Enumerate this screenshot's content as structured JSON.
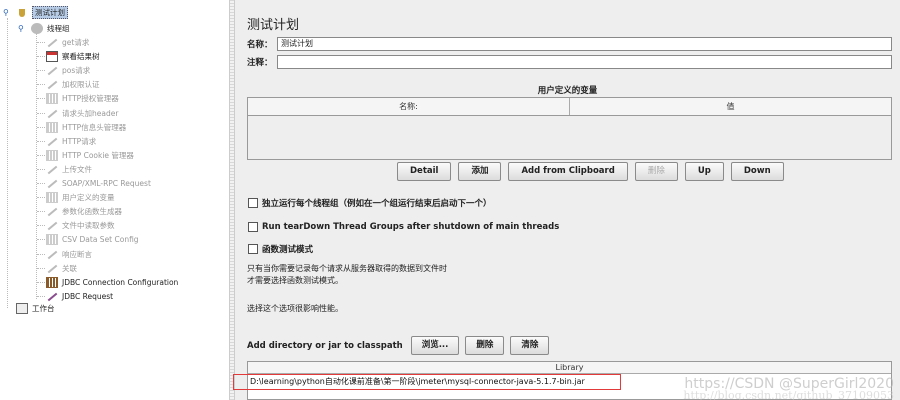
{
  "tree": {
    "root": {
      "label": "测试计划"
    },
    "thread_group": {
      "label": "线程组"
    },
    "items": [
      {
        "label": "get请求",
        "icon": "pen-icon",
        "enabled": false
      },
      {
        "label": "察看结果树",
        "icon": "results-tree-icon",
        "enabled": true
      },
      {
        "label": "pos请求",
        "icon": "pen-icon",
        "enabled": false
      },
      {
        "label": "加权限认证",
        "icon": "pen-icon",
        "enabled": false
      },
      {
        "label": "HTTP授权管理器",
        "icon": "config-grid-icon",
        "enabled": false
      },
      {
        "label": "请求头加header",
        "icon": "pen-icon",
        "enabled": false
      },
      {
        "label": "HTTP信息头管理器",
        "icon": "config-grid-icon",
        "enabled": false
      },
      {
        "label": "HTTP请求",
        "icon": "pen-icon",
        "enabled": false
      },
      {
        "label": "HTTP Cookie 管理器",
        "icon": "config-grid-icon",
        "enabled": false
      },
      {
        "label": "上传文件",
        "icon": "pen-icon",
        "enabled": false
      },
      {
        "label": "SOAP/XML-RPC Request",
        "icon": "pen-icon",
        "enabled": false
      },
      {
        "label": "用户定义的变量",
        "icon": "config-grid-icon",
        "enabled": false
      },
      {
        "label": "参数化函数生成器",
        "icon": "pen-icon",
        "enabled": false
      },
      {
        "label": "文件中读取参数",
        "icon": "pen-icon",
        "enabled": false
      },
      {
        "label": "CSV Data Set Config",
        "icon": "config-grid-icon",
        "enabled": false
      },
      {
        "label": "响应断言",
        "icon": "assertion-icon",
        "enabled": false
      },
      {
        "label": "关联",
        "icon": "pen-icon",
        "enabled": false
      },
      {
        "label": "JDBC Connection Configuration",
        "icon": "config-grid-icon",
        "enabled": true
      },
      {
        "label": "JDBC Request",
        "icon": "pen-icon",
        "enabled": true
      }
    ],
    "workbench": {
      "label": "工作台"
    }
  },
  "main": {
    "title": "测试计划",
    "name_label": "名称：",
    "name_value": "测试计划",
    "comment_label": "注释：",
    "comment_value": "",
    "vars_title": "用户定义的变量",
    "vars_columns": [
      "名称:",
      "值"
    ],
    "buttons": {
      "detail": "Detail",
      "add": "添加",
      "add_clipboard": "Add from Clipboard",
      "delete": "删除",
      "up": "Up",
      "down": "Down"
    },
    "checkboxes": {
      "serialize": "独立运行每个线程组（例如在一个组运行结束后启动下一个）",
      "teardown": "Run tearDown Thread Groups after shutdown of main threads",
      "functional": "函数测试模式"
    },
    "note_line1": "只有当你需要记录每个请求从服务器取得的数据到文件时",
    "note_line2": "才需要选择函数测试模式。",
    "note_line3": "选择这个选项很影响性能。",
    "classpath_label": "Add directory or jar to classpath",
    "classpath_buttons": {
      "browse": "浏览...",
      "delete": "删除",
      "clear": "清除"
    },
    "library_header": "Library",
    "library_rows": [
      "D:\\learning\\python自动化课前准备\\第一阶段\\jmeter\\mysql-connector-java-5.1.7-bin.jar"
    ]
  },
  "watermark": {
    "line1": "https://CSDN @SuperGirl2020",
    "line2": "http://blog.csdn.net/github_37109053"
  },
  "colors": {
    "selection": "#b7cce6",
    "highlight_border": "#e23a3a",
    "panel_bg": "#eeeeee"
  }
}
